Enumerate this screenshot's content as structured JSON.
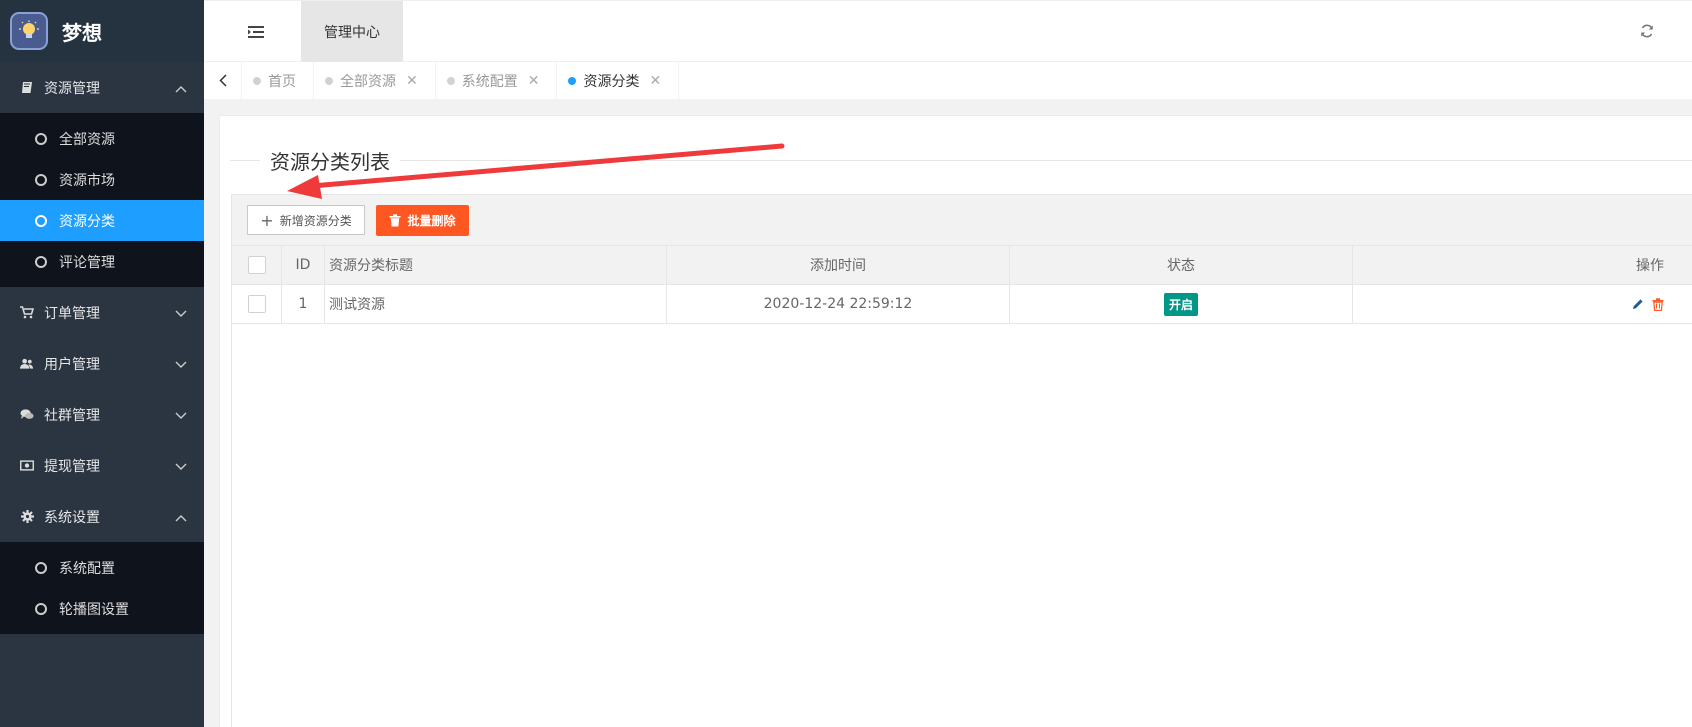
{
  "app": {
    "title": "梦想"
  },
  "sidebar": {
    "groups": [
      {
        "label": "资源管理",
        "icon": "book-icon",
        "expanded": true,
        "items": [
          {
            "label": "全部资源",
            "active": false
          },
          {
            "label": "资源市场",
            "active": false
          },
          {
            "label": "资源分类",
            "active": true
          },
          {
            "label": "评论管理",
            "active": false
          }
        ]
      },
      {
        "label": "订单管理",
        "icon": "cart-icon",
        "expanded": false
      },
      {
        "label": "用户管理",
        "icon": "users-icon",
        "expanded": false
      },
      {
        "label": "社群管理",
        "icon": "comments-icon",
        "expanded": false
      },
      {
        "label": "提现管理",
        "icon": "money-icon",
        "expanded": false
      },
      {
        "label": "系统设置",
        "icon": "gear-icon",
        "expanded": true,
        "items": [
          {
            "label": "系统配置",
            "active": false
          },
          {
            "label": "轮播图设置",
            "active": false
          }
        ]
      }
    ]
  },
  "header": {
    "active_tab": "管理中心"
  },
  "tabs": [
    {
      "label": "首页",
      "closable": false,
      "active": false
    },
    {
      "label": "全部资源",
      "closable": true,
      "active": false
    },
    {
      "label": "系统配置",
      "closable": true,
      "active": false
    },
    {
      "label": "资源分类",
      "closable": true,
      "active": true
    }
  ],
  "page": {
    "title": "资源分类列表"
  },
  "toolbar": {
    "add_label": "新增资源分类",
    "delete_label": "批量删除"
  },
  "table": {
    "columns": [
      "ID",
      "资源分类标题",
      "添加时间",
      "状态",
      "操作"
    ],
    "rows": [
      {
        "id": "1",
        "title": "测试资源",
        "time": "2020-12-24 22:59:12",
        "status": "开启"
      }
    ]
  },
  "colors": {
    "accent": "#1e9fff",
    "danger": "#ff5722",
    "success": "#009688",
    "sidebar": "#2b3542"
  }
}
